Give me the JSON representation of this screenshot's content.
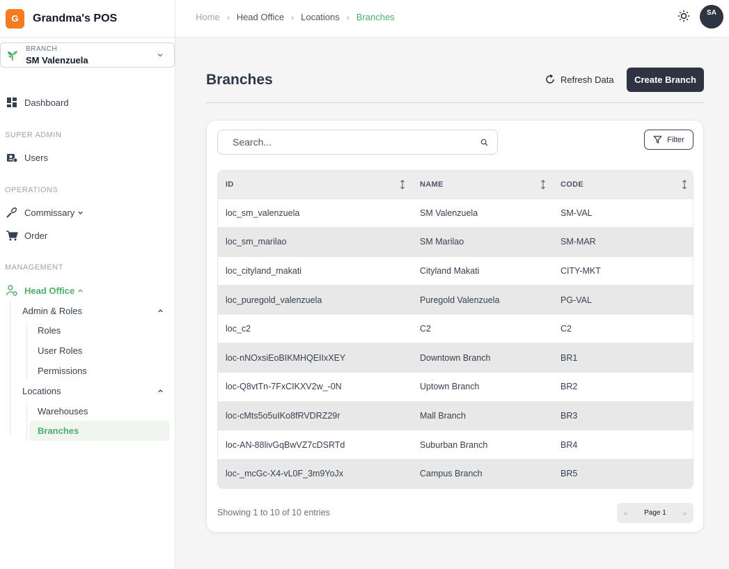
{
  "app": {
    "logo_letter": "G",
    "name": "Grandma's POS"
  },
  "branch_selector": {
    "label": "BRANCH",
    "value": "SM Valenzuela"
  },
  "sidebar": {
    "dashboard": "Dashboard",
    "super_admin_label": "SUPER ADMIN",
    "users": "Users",
    "operations_label": "OPERATIONS",
    "commissary": "Commissary",
    "order": "Order",
    "management_label": "MANAGEMENT",
    "head_office": "Head Office",
    "admin_roles": "Admin & Roles",
    "roles": "Roles",
    "user_roles": "User Roles",
    "permissions": "Permissions",
    "locations": "Locations",
    "warehouses": "Warehouses",
    "branches": "Branches"
  },
  "breadcrumb": [
    "Home",
    "Head Office",
    "Locations",
    "Branches"
  ],
  "user": {
    "initials": "SA"
  },
  "page": {
    "title": "Branches",
    "refresh_label": "Refresh Data",
    "create_label": "Create Branch"
  },
  "search": {
    "placeholder": "Search..."
  },
  "filter_label": "Filter",
  "table": {
    "columns": [
      "ID",
      "NAME",
      "CODE"
    ],
    "rows": [
      [
        "loc_sm_valenzuela",
        "SM Valenzuela",
        "SM-VAL"
      ],
      [
        "loc_sm_marilao",
        "SM Marilao",
        "SM-MAR"
      ],
      [
        "loc_cityland_makati",
        "Cityland Makati",
        "CITY-MKT"
      ],
      [
        "loc_puregold_valenzuela",
        "Puregold Valenzuela",
        "PG-VAL"
      ],
      [
        "loc_c2",
        "C2",
        "C2"
      ],
      [
        "loc-nNOxsiEoBIKMHQEIIxXEY",
        "Downtown Branch",
        "BR1"
      ],
      [
        "loc-Q8vtTn-7FxCIKXV2w_-0N",
        "Uptown Branch",
        "BR2"
      ],
      [
        "loc-cMts5o5uIKo8fRVDRZ29r",
        "Mall Branch",
        "BR3"
      ],
      [
        "loc-AN-88livGqBwVZ7cDSRTd",
        "Suburban Branch",
        "BR4"
      ],
      [
        "loc-_mcGc-X4-vL0F_3m9YoJx",
        "Campus Branch",
        "BR5"
      ]
    ]
  },
  "footer": {
    "entries_text": "Showing 1 to 10 of 10 entries",
    "page_label": "Page 1"
  },
  "colors": {
    "brand": "#f47c20",
    "accent": "#4caf6a",
    "dark": "#2f3441"
  }
}
